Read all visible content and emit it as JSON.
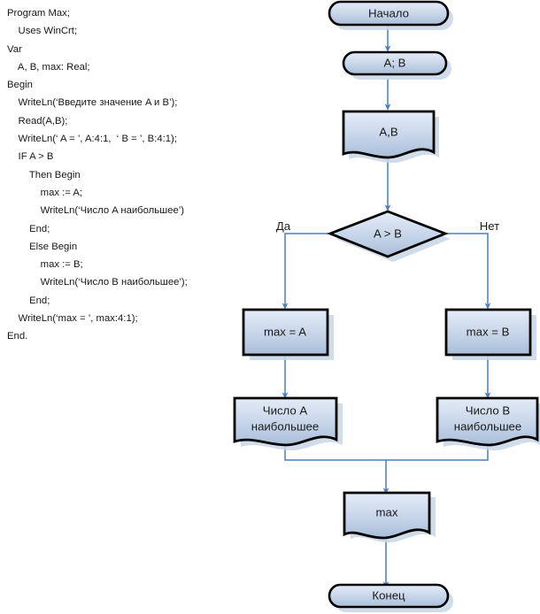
{
  "code": {
    "language": "Pascal",
    "lines": [
      "Program Max;",
      "    Uses WinCrt;",
      "Var",
      "    A, B, max: Real;",
      "Begin",
      "    WriteLn(‘Введите значение A и B’);",
      "    Read(A,B);",
      "    WriteLn(‘ A = ’, A:4:1,  ‘ B = ’, B:4:1);",
      "    IF A > B",
      "        Then Begin",
      "            max := A;",
      "            WriteLn(‘Число A наибольшее’)",
      "        End;",
      "        Else Begin",
      "            max := B;",
      "            WriteLn(‘Число B наибольшее’);",
      "        End;",
      "    WriteLn(‘max = ’, max:4:1);",
      "End."
    ]
  },
  "flowchart": {
    "colors": {
      "fill_top": "#dce6f2",
      "fill_bottom": "#a7bcd8",
      "outline": "#000000",
      "connector": "#4a7ebb",
      "shadow": "#c6d3e6"
    },
    "nodes": {
      "start": {
        "label": "Начало",
        "type": "terminator"
      },
      "input_vars": {
        "label": "A; B",
        "type": "preparation"
      },
      "read_ab": {
        "label": "A,B",
        "type": "document"
      },
      "decision": {
        "label": "A > B",
        "type": "decision"
      },
      "assign_a": {
        "label": "max = A",
        "type": "process"
      },
      "assign_b": {
        "label": "max = B",
        "type": "process"
      },
      "print_a": {
        "label": "Число A\nнаибольшее",
        "line1": "Число A",
        "line2": "наибольшее",
        "type": "document"
      },
      "print_b": {
        "label": "Число B\nнаибольшее",
        "line1": "Число B",
        "line2": "наибольшее",
        "type": "document"
      },
      "print_max": {
        "label": "max",
        "type": "document"
      },
      "end": {
        "label": "Конец",
        "type": "terminator"
      }
    },
    "branch_labels": {
      "yes": "Да",
      "no": "Нет"
    }
  }
}
